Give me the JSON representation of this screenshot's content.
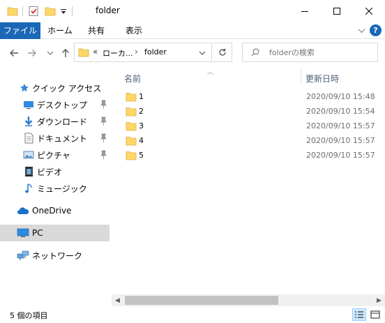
{
  "window": {
    "title": "folder",
    "minimize_glyph": "─",
    "maximize_glyph": "☐",
    "close_glyph": "✕"
  },
  "ribbon": {
    "tabs": [
      {
        "label": "ファイル"
      },
      {
        "label": "ホーム"
      },
      {
        "label": "共有"
      },
      {
        "label": "表示"
      }
    ],
    "expand_glyph": "﹀",
    "help_glyph": "?"
  },
  "address": {
    "prefix": "«",
    "crumbs": [
      "ローカ...",
      "folder"
    ],
    "separator": "›"
  },
  "search": {
    "placeholder": "folderの検索"
  },
  "sidebar": {
    "items": [
      {
        "label": "クイック アクセス",
        "icon": "star-icon",
        "pinned": false
      },
      {
        "label": "デスクトップ",
        "icon": "desktop-icon",
        "pinned": true
      },
      {
        "label": "ダウンロード",
        "icon": "download-icon",
        "pinned": true
      },
      {
        "label": "ドキュメント",
        "icon": "document-icon",
        "pinned": true
      },
      {
        "label": "ピクチャ",
        "icon": "pictures-icon",
        "pinned": true
      },
      {
        "label": "ビデオ",
        "icon": "video-icon",
        "pinned": false
      },
      {
        "label": "ミュージック",
        "icon": "music-icon",
        "pinned": false
      },
      {
        "label": "OneDrive",
        "icon": "cloud-icon",
        "pinned": false
      },
      {
        "label": "PC",
        "icon": "pc-icon",
        "pinned": false,
        "selected": true
      },
      {
        "label": "ネットワーク",
        "icon": "network-icon",
        "pinned": false
      }
    ]
  },
  "columns": {
    "name": "名前",
    "date": "更新日時"
  },
  "files": [
    {
      "name": "1",
      "date": "2020/09/10 15:48"
    },
    {
      "name": "2",
      "date": "2020/09/10 15:54"
    },
    {
      "name": "3",
      "date": "2020/09/10 15:57"
    },
    {
      "name": "4",
      "date": "2020/09/10 15:57"
    },
    {
      "name": "5",
      "date": "2020/09/10 15:57"
    }
  ],
  "status": {
    "text": "5 個の項目"
  },
  "colors": {
    "accent": "#1a67b5",
    "folder": "#ffd766",
    "selected": "#d9d9d9"
  }
}
